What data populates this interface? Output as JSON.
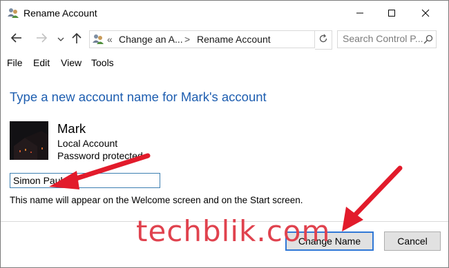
{
  "window": {
    "title": "Rename Account"
  },
  "address_bar": {
    "separator": "«",
    "crumb_1": "Change an A...",
    "crumb_arrow": ">",
    "crumb_2": "Rename Account"
  },
  "search": {
    "placeholder": "Search Control P..."
  },
  "menu": {
    "file": "File",
    "edit": "Edit",
    "view": "View",
    "tools": "Tools"
  },
  "content": {
    "heading": "Type a new account name for Mark's account",
    "user_name": "Mark",
    "account_type": "Local Account",
    "password_status": "Password protected",
    "name_field_value": "Simon Paul",
    "hint": "This name will appear on the Welcome screen and on the Start screen."
  },
  "buttons": {
    "change_name": "Change Name",
    "cancel": "Cancel"
  },
  "watermark": "techblik.com",
  "colors": {
    "accent": "#1e5eb0",
    "arrow": "#e21b2b",
    "watermark": "#e0424e",
    "focus_border": "#3078d6"
  },
  "icons": {
    "app": "users-icon",
    "minimize": "minimize-icon",
    "maximize": "maximize-icon",
    "close": "close-icon",
    "back": "back-arrow-icon",
    "forward": "forward-arrow-icon",
    "recent": "chevron-down-icon",
    "up": "up-arrow-icon",
    "refresh": "refresh-icon",
    "search": "search-icon"
  }
}
